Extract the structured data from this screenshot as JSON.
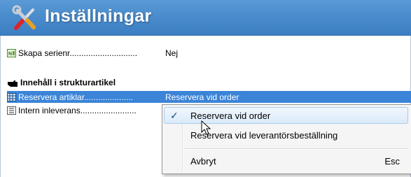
{
  "window": {
    "title": "Inställningar"
  },
  "settings": {
    "rows": [
      {
        "label": "Skapa serienr.............................",
        "value": "Nej"
      },
      {
        "label": "Reservera artiklar.....................",
        "value": "Reservera vid order"
      },
      {
        "label": "Intern inleverans........................",
        "value": ""
      }
    ],
    "section_title": "Innehåll i strukturartikel"
  },
  "context_menu": {
    "items": [
      {
        "label": "Reservera vid order",
        "checked": true
      },
      {
        "label": "Reservera vid leverantörsbeställning",
        "checked": false
      },
      {
        "label": "Avbryt",
        "shortcut": "Esc"
      }
    ],
    "check_mark": "✓"
  },
  "colors": {
    "titlebar": "#4a8ccc",
    "selection": "#3b84d8"
  }
}
